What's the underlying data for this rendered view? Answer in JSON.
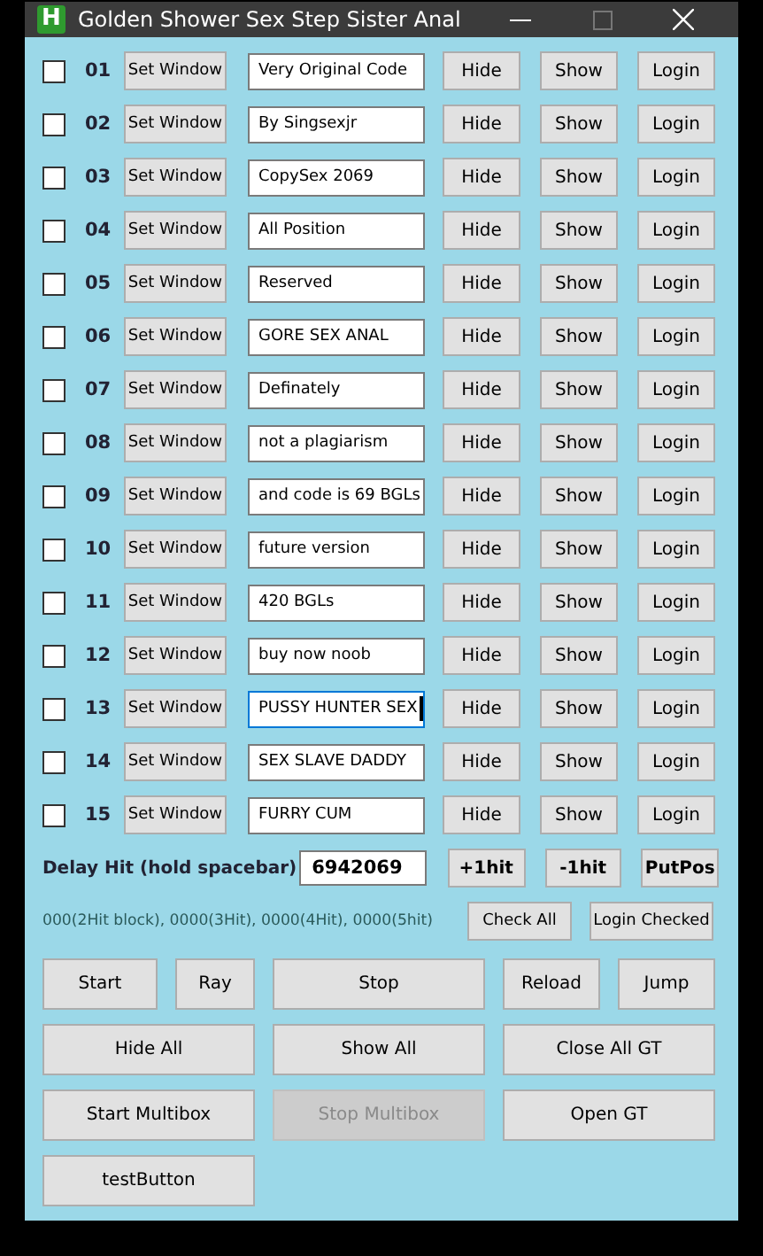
{
  "window": {
    "title": "Golden Shower Sex Step Sister Anal",
    "app_icon_letter": "H"
  },
  "rows": [
    {
      "checked": false,
      "number": "01",
      "set_label": "Set Window",
      "value": "Very Original Code",
      "focused": false,
      "hide": "Hide",
      "show": "Show",
      "login": "Login"
    },
    {
      "checked": false,
      "number": "02",
      "set_label": "Set Window",
      "value": "By Singsexjr",
      "focused": false,
      "hide": "Hide",
      "show": "Show",
      "login": "Login"
    },
    {
      "checked": false,
      "number": "03",
      "set_label": "Set Window",
      "value": "CopySex 2069",
      "focused": false,
      "hide": "Hide",
      "show": "Show",
      "login": "Login"
    },
    {
      "checked": false,
      "number": "04",
      "set_label": "Set Window",
      "value": "All Position",
      "focused": false,
      "hide": "Hide",
      "show": "Show",
      "login": "Login"
    },
    {
      "checked": false,
      "number": "05",
      "set_label": "Set Window",
      "value": "Reserved",
      "focused": false,
      "hide": "Hide",
      "show": "Show",
      "login": "Login"
    },
    {
      "checked": false,
      "number": "06",
      "set_label": "Set Window",
      "value": "GORE SEX ANAL",
      "focused": false,
      "hide": "Hide",
      "show": "Show",
      "login": "Login"
    },
    {
      "checked": false,
      "number": "07",
      "set_label": "Set Window",
      "value": "Definately",
      "focused": false,
      "hide": "Hide",
      "show": "Show",
      "login": "Login"
    },
    {
      "checked": false,
      "number": "08",
      "set_label": "Set Window",
      "value": "not a plagiarism",
      "focused": false,
      "hide": "Hide",
      "show": "Show",
      "login": "Login"
    },
    {
      "checked": false,
      "number": "09",
      "set_label": "Set Window",
      "value": "and code is 69 BGLs",
      "focused": false,
      "hide": "Hide",
      "show": "Show",
      "login": "Login"
    },
    {
      "checked": false,
      "number": "10",
      "set_label": "Set Window",
      "value": "future version",
      "focused": false,
      "hide": "Hide",
      "show": "Show",
      "login": "Login"
    },
    {
      "checked": false,
      "number": "11",
      "set_label": "Set Window",
      "value": "420 BGLs",
      "focused": false,
      "hide": "Hide",
      "show": "Show",
      "login": "Login"
    },
    {
      "checked": false,
      "number": "12",
      "set_label": "Set Window",
      "value": "buy now noob",
      "focused": false,
      "hide": "Hide",
      "show": "Show",
      "login": "Login"
    },
    {
      "checked": false,
      "number": "13",
      "set_label": "Set Window",
      "value": "PUSSY HUNTER SEX",
      "focused": true,
      "hide": "Hide",
      "show": "Show",
      "login": "Login"
    },
    {
      "checked": false,
      "number": "14",
      "set_label": "Set Window",
      "value": "SEX SLAVE DADDY",
      "focused": false,
      "hide": "Hide",
      "show": "Show",
      "login": "Login"
    },
    {
      "checked": false,
      "number": "15",
      "set_label": "Set Window",
      "value": "FURRY CUM",
      "focused": false,
      "hide": "Hide",
      "show": "Show",
      "login": "Login"
    }
  ],
  "delay": {
    "label": "Delay Hit (hold spacebar)",
    "value": "6942069",
    "buttons": [
      "+1hit",
      "-1hit",
      "PutPos"
    ]
  },
  "status": {
    "text": "000(2Hit block), 0000(3Hit), 0000(4Hit), 0000(5hit)",
    "buttons": [
      "Check All",
      "Login Checked"
    ]
  },
  "button_rows": [
    [
      {
        "label": "Start",
        "disabled": false
      },
      {
        "label": "Ray",
        "disabled": false
      },
      {
        "label": "Stop",
        "disabled": false
      },
      {
        "label": "Reload",
        "disabled": false
      },
      {
        "label": "Jump",
        "disabled": false
      }
    ],
    [
      {
        "label": "Hide All",
        "disabled": false
      },
      {
        "label": "Show All",
        "disabled": false
      },
      {
        "label": "Close All GT",
        "disabled": false
      }
    ],
    [
      {
        "label": "Start Multibox",
        "disabled": false
      },
      {
        "label": "Stop Multibox",
        "disabled": true
      },
      {
        "label": "Open GT",
        "disabled": false
      }
    ],
    [
      {
        "label": "testButton",
        "disabled": false
      }
    ]
  ]
}
